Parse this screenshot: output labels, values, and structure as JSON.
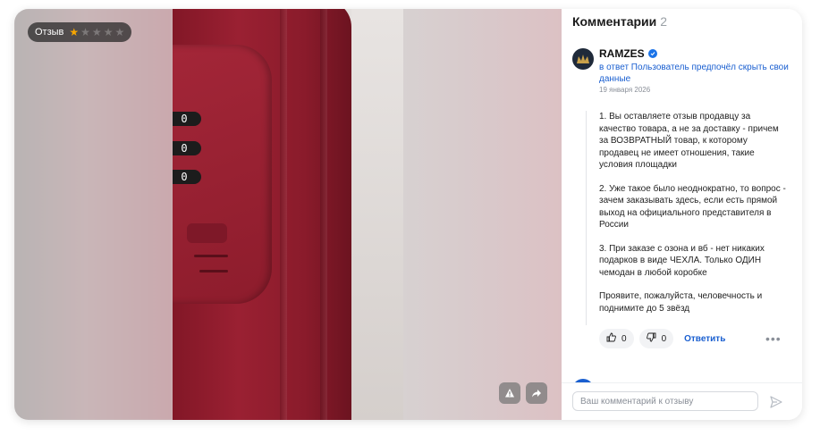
{
  "media": {
    "badge_label": "Отзыв",
    "rating": 1,
    "max_rating": 5,
    "dial_digits": [
      "0",
      "0",
      "0"
    ],
    "icons": [
      "warning-icon",
      "share-icon"
    ]
  },
  "comments": {
    "title": "Комментарии",
    "count": "2",
    "comment": {
      "author": "RAMZES",
      "reply_to": "в ответ Пользователь предпочёл скрыть свои данные",
      "date": "19 января 2026",
      "paragraphs": [
        "1. Вы оставляете отзыв продавцу за качество товара, а не за доставку - причем за ВОЗВРАТНЫЙ товар, к которому продавец не имеет отношения, такие условия площадки",
        "2. Уже такое было неоднократно, то вопрос - зачем заказывать здесь, если есть прямой выход на официального представителя в России",
        "3. При заказе с озона и вб - нет никаких подарков в виде ЧЕХЛА. Только ОДИН чемодан в любой коробке",
        "Проявите, пожалуйста, человечность и поднимите до 5 звёзд"
      ],
      "likes": "0",
      "dislikes": "0",
      "reply_label": "Ответить",
      "more_label": "•••"
    },
    "input_placeholder": "Ваш комментарий к отзыву",
    "input_value": ""
  },
  "colors": {
    "accent": "#1a5fd0",
    "star": "#f7a600",
    "suitcase": "#9a2032"
  }
}
